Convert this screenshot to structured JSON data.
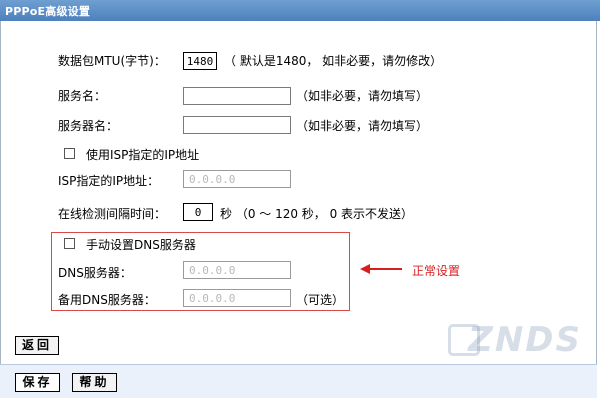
{
  "window": {
    "title": "PPPoE高级设置"
  },
  "mtu": {
    "label": "数据包MTU(字节)：",
    "value": "1480",
    "note": "（ 默认是1480， 如非必要，请勿修改）"
  },
  "service_name": {
    "label": "服务名：",
    "value": "",
    "note": "（如非必要，请勿填写）"
  },
  "server_name": {
    "label": "服务器名：",
    "value": "",
    "note": "（如非必要，请勿填写）"
  },
  "use_isp_ip": {
    "label": "使用ISP指定的IP地址",
    "checked": false
  },
  "isp_ip": {
    "label": "ISP指定的IP地址：",
    "value": "0.0.0.0"
  },
  "detect_interval": {
    "label": "在线检测间隔时间：",
    "value": "0",
    "note": "秒 （0 ～ 120 秒， 0 表示不发送）"
  },
  "manual_dns": {
    "label": "手动设置DNS服务器",
    "checked": false
  },
  "dns_primary": {
    "label": "DNS服务器：",
    "value": "0.0.0.0"
  },
  "dns_secondary": {
    "label": "备用DNS服务器：",
    "value": "0.0.0.0",
    "note": "（可选）"
  },
  "annotation": {
    "text": "正常设置",
    "color": "#d81f1f"
  },
  "buttons": {
    "back": "返回",
    "save": "保存",
    "help": "帮助"
  },
  "watermark": {
    "text": "ZNDS"
  },
  "colors": {
    "titlebar": "#5a8bc6",
    "highlight_box": "#d64a4a"
  }
}
